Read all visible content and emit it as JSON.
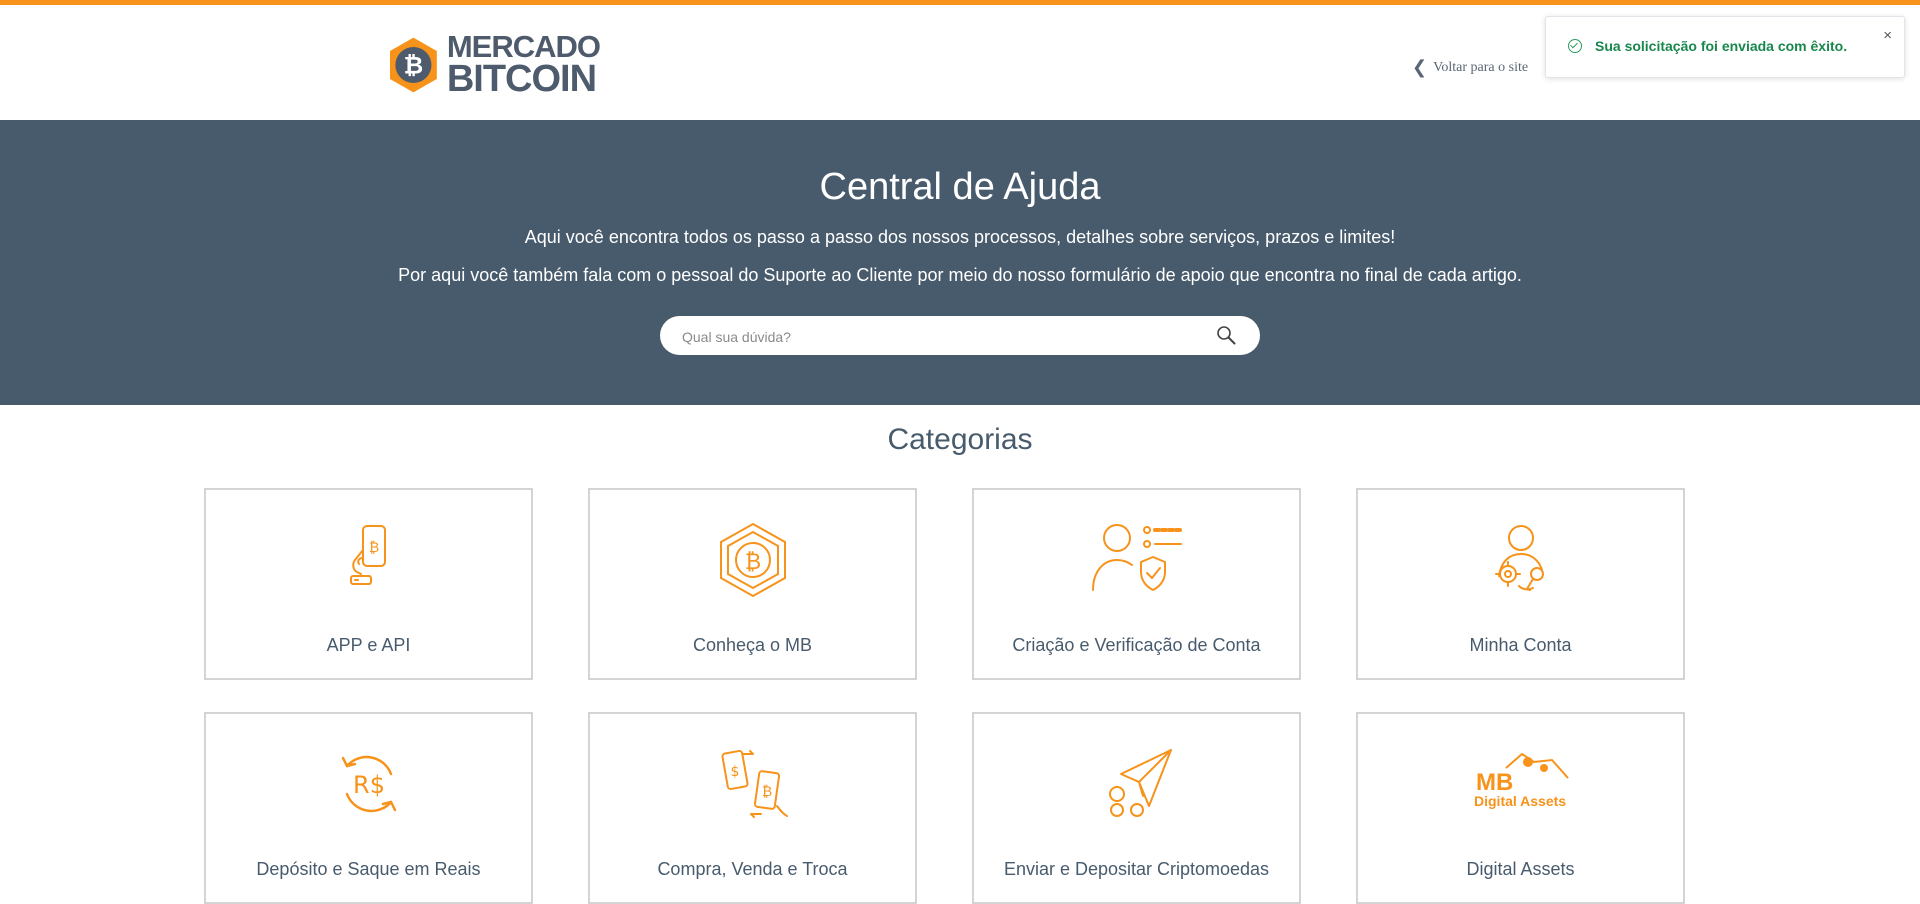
{
  "brand": {
    "line1": "MERCADO",
    "line2": "BITCOIN",
    "accent": "#f7931a",
    "text_color": "#4d5b6c"
  },
  "header": {
    "back_label": "Voltar para o site"
  },
  "toast": {
    "message": "Sua solicitação foi enviada com êxito.",
    "close": "×",
    "status": "success"
  },
  "hero": {
    "title": "Central de Ajuda",
    "subtitle1": "Aqui você encontra todos os passo a passo dos nossos processos, detalhes sobre serviços, prazos e limites!",
    "subtitle2": "Por aqui você também fala com o pessoal do Suporte ao Cliente por meio do nosso formulário de apoio que encontra no final de cada artigo.",
    "background": "#485b6d"
  },
  "search": {
    "placeholder": "Qual sua dúvida?",
    "value": ""
  },
  "categories": {
    "title": "Categorias",
    "items": [
      {
        "label": "APP e API",
        "icon": "phone-bitcoin-icon"
      },
      {
        "label": "Conheça o MB",
        "icon": "hexagon-bitcoin-icon"
      },
      {
        "label": "Criação e Verificação de Conta",
        "icon": "user-shield-icon"
      },
      {
        "label": "Minha Conta",
        "icon": "user-gear-icon"
      },
      {
        "label": "Depósito e Saque em Reais",
        "icon": "currency-exchange-icon"
      },
      {
        "label": "Compra, Venda e Troca",
        "icon": "phones-exchange-icon"
      },
      {
        "label": "Enviar e Depositar Criptomoedas",
        "icon": "paper-plane-icon"
      },
      {
        "label": "Digital Assets",
        "icon": "mb-digital-assets-logo",
        "logo_text1": "MB",
        "logo_text2": "Digital Assets"
      }
    ]
  }
}
